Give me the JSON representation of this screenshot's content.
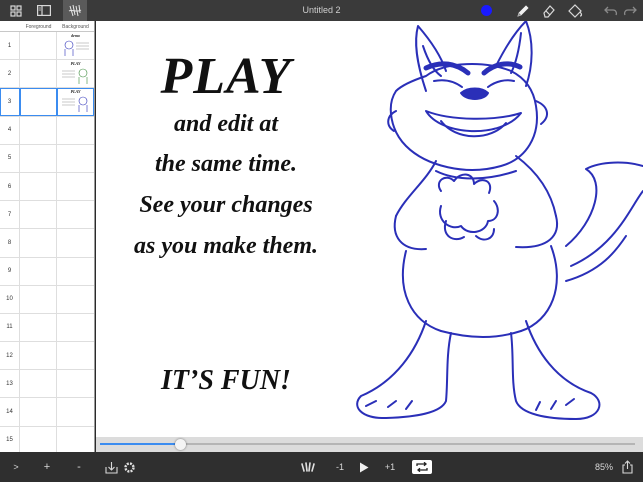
{
  "window": {
    "title": "Untitled 2"
  },
  "toolbar": {
    "left_icons": [
      "grid-icon",
      "sidebar-icon",
      "layers-icon"
    ],
    "right_icons": [
      "color-swatch-icon",
      "pencil-icon",
      "eraser-icon",
      "fill-icon",
      "undo-icon",
      "redo-icon"
    ],
    "brush_color": "#1a1aff"
  },
  "layers_panel": {
    "columns": [
      "Foreground",
      "Background"
    ],
    "frames": [
      "1",
      "2",
      "3",
      "4",
      "5",
      "6",
      "7",
      "8",
      "9",
      "10",
      "11",
      "12",
      "13",
      "14",
      "15"
    ],
    "selected_frame": "3",
    "footer": {
      "expand_label": ">",
      "add_label": "+",
      "remove_label": "-"
    }
  },
  "canvas": {
    "headline": "PLAY",
    "lines": [
      "and edit at",
      "the same time.",
      "See your changes",
      "as you make them."
    ],
    "tagline": "IT’S FUN!",
    "drawing_color": "#2a2fb8",
    "frame_thumbs": {
      "frame1": "demo",
      "frame2": "PLAY",
      "frame3": "PLAY"
    }
  },
  "timeline": {
    "position": 0.15,
    "accent": "#3b8cf0"
  },
  "bottom_bar": {
    "prev_label": "-1",
    "next_label": "+1",
    "zoom": "85%"
  }
}
